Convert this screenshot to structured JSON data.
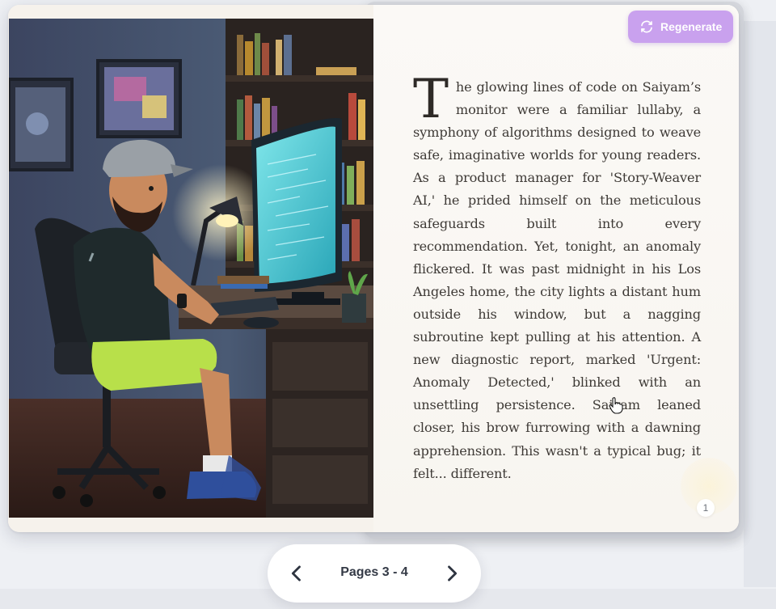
{
  "toolbar": {
    "regenerate_label": "Regenerate"
  },
  "story": {
    "dropcap": "T",
    "text": "he glowing lines of code on Saiyam’s monitor were a familiar lullaby, a symphony of algorithms designed to weave safe, imaginative worlds for young readers. As a product manager for 'Story-Weaver AI,' he prided himself on the meticulous safeguards built into every recommendation. Yet, tonight, an anomaly flickered. It was past midnight in his Los Angeles home, the city lights a distant hum outside his window, but a nagging subroutine kept pulling at his attention. A new diagnostic report, marked 'Urgent: Anomaly Detected,' blinked with an unsettling persistence. Saiyam leaned closer, his brow furrowing with a dawning apprehension. This wasn't a typical bug; it felt... different.",
    "page_number": "1"
  },
  "pager": {
    "label": "Pages 3 - 4"
  },
  "icons": {
    "regenerate": "refresh-icon",
    "prev": "chevron-left-icon",
    "next": "chevron-right-icon"
  },
  "colors": {
    "accent": "#c9a1ee",
    "text": "#3e3a36",
    "pager_text": "#343a46"
  }
}
